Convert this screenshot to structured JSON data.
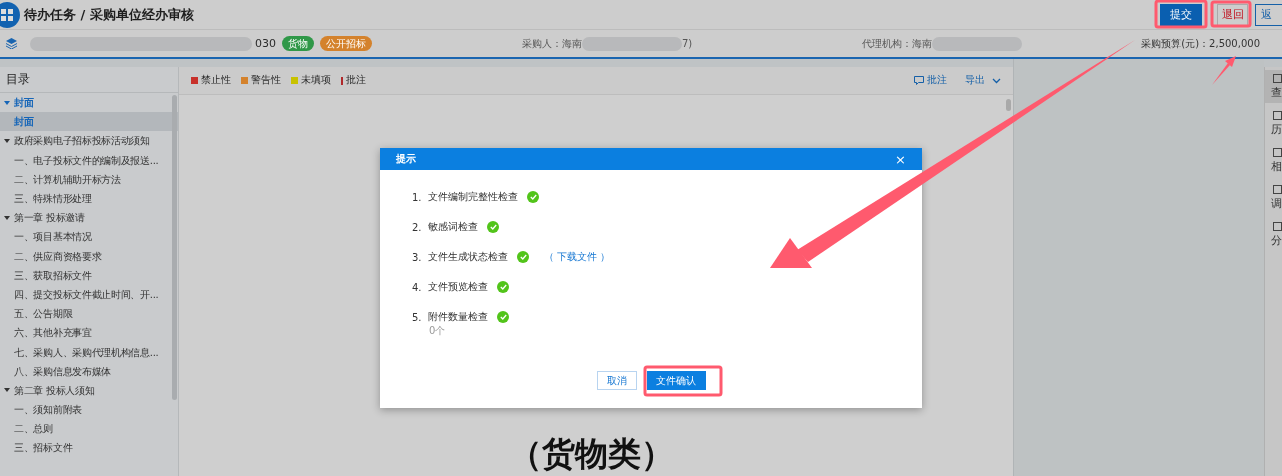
{
  "header": {
    "title": "待办任务 / 采购单位经办审核",
    "buttons": [
      {
        "label": "提交",
        "kind": "primary"
      },
      {
        "label": "退回",
        "kind": "danger"
      },
      {
        "label": "返",
        "kind": "plain"
      }
    ]
  },
  "info_bar": {
    "project_suffix": "030",
    "tags": [
      {
        "label": "货物",
        "color": "#2f9848"
      },
      {
        "label": "公开招标",
        "color": "#d4822c"
      }
    ],
    "purchaser_label": "采购人：海南",
    "purchaser_suffix": "7)",
    "agency_label": "代理机构：海南",
    "budget": "采购预算(元)：2,500,000"
  },
  "toc": {
    "title": "目录",
    "items": [
      {
        "label": "封面",
        "expanded": true,
        "children": [
          {
            "label": "封面",
            "selected": true
          }
        ]
      },
      {
        "label": "政府采购电子招标投标活动须知",
        "expanded": true,
        "children": [
          {
            "label": "一、电子投标文件的编制及报送...",
            "selected": false
          },
          {
            "label": "二、计算机辅助开标方法",
            "selected": false
          },
          {
            "label": "三、特殊情形处理",
            "selected": false
          }
        ]
      },
      {
        "label": "第一章 投标邀请",
        "expanded": true,
        "children": [
          {
            "label": "一、项目基本情况",
            "selected": false
          },
          {
            "label": "二、供应商资格要求",
            "selected": false
          },
          {
            "label": "三、获取招标文件",
            "selected": false
          },
          {
            "label": "四、提交投标文件截止时间、开...",
            "selected": false
          },
          {
            "label": "五、公告期限",
            "selected": false
          },
          {
            "label": "六、其他补充事宜",
            "selected": false
          },
          {
            "label": "七、采购人、采购代理机构信息...",
            "selected": false
          },
          {
            "label": "八、采购信息发布媒体",
            "selected": false
          }
        ]
      },
      {
        "label": "第二章 投标人须知",
        "expanded": true,
        "children": [
          {
            "label": "一、须知前附表",
            "selected": false
          },
          {
            "label": "二、总则",
            "selected": false
          },
          {
            "label": "三、招标文件",
            "selected": false
          }
        ]
      }
    ]
  },
  "legend": [
    {
      "label": "禁止性",
      "color": "#c8302a",
      "kind": "square"
    },
    {
      "label": "警告性",
      "color": "#d4822c",
      "kind": "square"
    },
    {
      "label": "未填项",
      "color": "#c8c200",
      "kind": "square"
    },
    {
      "label": "批注",
      "color": "#b0282a",
      "kind": "bar"
    }
  ],
  "toolbar": [
    {
      "label": "批注",
      "kind": "comment"
    },
    {
      "label": "导出",
      "kind": "dropdown"
    }
  ],
  "document": {
    "heading": "（货物类）"
  },
  "side_rail": [
    {
      "label": "查",
      "selected": true
    },
    {
      "label": "历",
      "selected": false
    },
    {
      "label": "相",
      "selected": false
    },
    {
      "label": "调",
      "selected": false
    },
    {
      "label": "分",
      "selected": false
    }
  ],
  "dialog": {
    "title": "提示",
    "close": "×",
    "checks": [
      {
        "number": "1.",
        "label": "文件编制完整性检查",
        "passed": true
      },
      {
        "number": "2.",
        "label": "敏感词检查",
        "passed": true
      },
      {
        "number": "3.",
        "label": "文件生成状态检查",
        "passed": true,
        "link": "（ 下载文件 ）"
      },
      {
        "number": "4.",
        "label": "文件预览检查",
        "passed": true
      },
      {
        "number": "5.",
        "label": "附件数量检查",
        "passed": true,
        "note": "0个"
      }
    ],
    "buttons": [
      {
        "label": "取消",
        "kind": "plain"
      },
      {
        "label": "文件确认",
        "kind": "primary"
      }
    ]
  }
}
